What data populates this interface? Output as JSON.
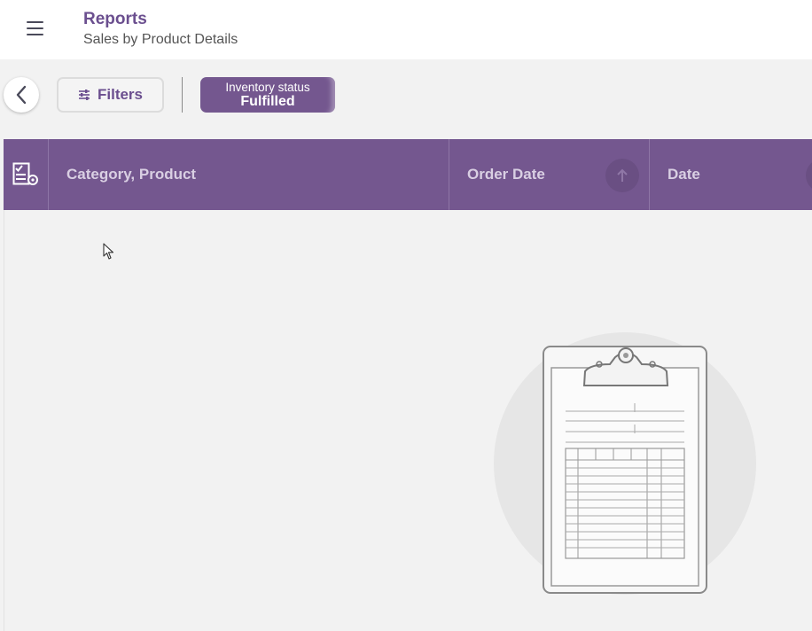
{
  "header": {
    "title": "Reports",
    "subtitle": "Sales by Product Details"
  },
  "toolbar": {
    "filters_label": "Filters",
    "chip": {
      "label": "Inventory status",
      "value": "Fulfilled"
    }
  },
  "table": {
    "columns": [
      {
        "label": "Category, Product"
      },
      {
        "label": "Order Date",
        "sort": "ascending"
      },
      {
        "label": "Date"
      }
    ],
    "rows": []
  },
  "icons": {
    "menu": "hamburger-icon",
    "back": "chevron-left-icon",
    "filters": "sliders-icon",
    "column_select": "column-checklist-icon",
    "sort": "arrow-up-icon",
    "empty_state": "clipboard-illustration"
  },
  "colors": {
    "brand": "#74578f",
    "title": "#6b4f8f",
    "background": "#f2f2f2"
  }
}
